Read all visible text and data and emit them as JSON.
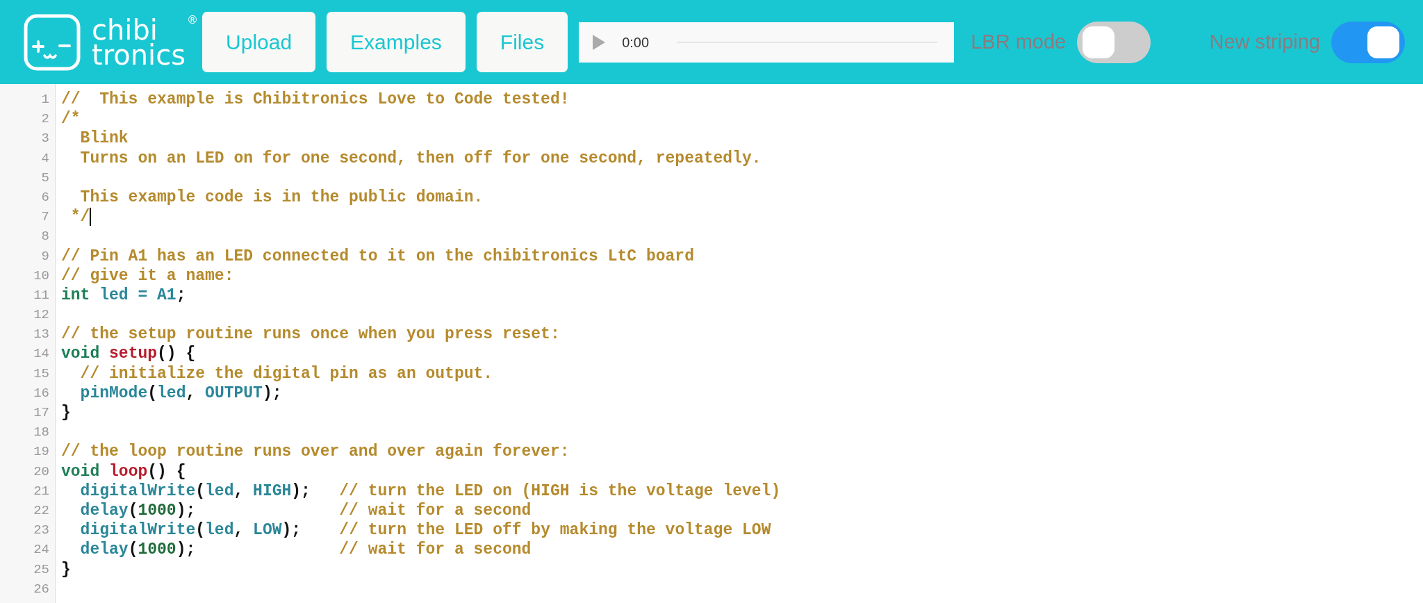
{
  "header": {
    "logo": {
      "line_1": "chibi",
      "line_2": "tronics",
      "mark": "®"
    },
    "buttons": [
      "Upload",
      "Examples",
      "Files"
    ],
    "player": {
      "time": "0:00"
    },
    "toggles": [
      {
        "label": "LBR mode",
        "on": false
      },
      {
        "label": "New striping",
        "on": true
      }
    ]
  },
  "editor": {
    "lines": [
      {
        "number": "1",
        "tokens": [
          {
            "kind": "comment",
            "text": "//  This example is Chibitronics Love to Code tested!"
          }
        ]
      },
      {
        "number": "2",
        "tokens": [
          {
            "kind": "comment",
            "text": "/*"
          }
        ]
      },
      {
        "number": "3",
        "tokens": [
          {
            "kind": "comment",
            "text": "  Blink"
          }
        ]
      },
      {
        "number": "4",
        "tokens": [
          {
            "kind": "comment",
            "text": "  Turns on an LED on for one second, then off for one second, repeatedly."
          }
        ]
      },
      {
        "number": "5"
      },
      {
        "number": "6",
        "tokens": [
          {
            "kind": "comment",
            "text": "  This example code is in the public domain."
          }
        ]
      },
      {
        "number": "7",
        "cursor": true,
        "tokens": [
          {
            "kind": "comment",
            "text": " */"
          }
        ]
      },
      {
        "number": "8"
      },
      {
        "number": "9",
        "tokens": [
          {
            "kind": "comment",
            "text": "// Pin A1 has an LED connected to it on the chibitronics LtC board"
          }
        ]
      },
      {
        "number": "10",
        "tokens": [
          {
            "kind": "comment",
            "text": "// give it a name:"
          }
        ]
      },
      {
        "number": "11",
        "tokens": [
          {
            "kind": "type",
            "text": "int"
          },
          {
            "kind": "name",
            "text": " led = A1"
          },
          {
            "kind": "plain",
            "text": ";"
          }
        ]
      },
      {
        "number": "12"
      },
      {
        "number": "13",
        "tokens": [
          {
            "kind": "comment",
            "text": "// the setup routine runs once when you press reset:"
          }
        ]
      },
      {
        "number": "14",
        "tokens": [
          {
            "kind": "type",
            "text": "void"
          },
          {
            "kind": "function",
            "text": " setup"
          },
          {
            "kind": "plain",
            "text": "() {"
          }
        ]
      },
      {
        "number": "15",
        "tokens": [
          {
            "kind": "comment",
            "text": "  // initialize the digital pin as an output."
          }
        ]
      },
      {
        "number": "16",
        "tokens": [
          {
            "kind": "name",
            "text": "  pinMode"
          },
          {
            "kind": "plain",
            "text": "("
          },
          {
            "kind": "name",
            "text": "led"
          },
          {
            "kind": "plain",
            "text": ", "
          },
          {
            "kind": "name",
            "text": "OUTPUT"
          },
          {
            "kind": "plain",
            "text": ");"
          }
        ]
      },
      {
        "number": "17",
        "tokens": [
          {
            "kind": "plain",
            "text": "}"
          }
        ]
      },
      {
        "number": "18"
      },
      {
        "number": "19",
        "tokens": [
          {
            "kind": "comment",
            "text": "// the loop routine runs over and over again forever:"
          }
        ]
      },
      {
        "number": "20",
        "tokens": [
          {
            "kind": "type",
            "text": "void"
          },
          {
            "kind": "function",
            "text": " loop"
          },
          {
            "kind": "plain",
            "text": "() {"
          }
        ]
      },
      {
        "number": "21",
        "tokens": [
          {
            "kind": "name",
            "text": "  digitalWrite"
          },
          {
            "kind": "plain",
            "text": "("
          },
          {
            "kind": "name",
            "text": "led"
          },
          {
            "kind": "plain",
            "text": ", "
          },
          {
            "kind": "name",
            "text": "HIGH"
          },
          {
            "kind": "plain",
            "text": ");   "
          },
          {
            "kind": "comment",
            "text": "// turn the LED on (HIGH is the voltage level)"
          }
        ]
      },
      {
        "number": "22",
        "tokens": [
          {
            "kind": "name",
            "text": "  delay"
          },
          {
            "kind": "plain",
            "text": "("
          },
          {
            "kind": "number",
            "text": "1000"
          },
          {
            "kind": "plain",
            "text": ");               "
          },
          {
            "kind": "comment",
            "text": "// wait for a second"
          }
        ]
      },
      {
        "number": "23",
        "tokens": [
          {
            "kind": "name",
            "text": "  digitalWrite"
          },
          {
            "kind": "plain",
            "text": "("
          },
          {
            "kind": "name",
            "text": "led"
          },
          {
            "kind": "plain",
            "text": ", "
          },
          {
            "kind": "name",
            "text": "LOW"
          },
          {
            "kind": "plain",
            "text": ");    "
          },
          {
            "kind": "comment",
            "text": "// turn the LED off by making the voltage LOW"
          }
        ]
      },
      {
        "number": "24",
        "tokens": [
          {
            "kind": "name",
            "text": "  delay"
          },
          {
            "kind": "plain",
            "text": "("
          },
          {
            "kind": "number",
            "text": "1000"
          },
          {
            "kind": "plain",
            "text": ");               "
          },
          {
            "kind": "comment",
            "text": "// wait for a second"
          }
        ]
      },
      {
        "number": "25",
        "tokens": [
          {
            "kind": "plain",
            "text": "}"
          }
        ]
      },
      {
        "number": "26"
      }
    ]
  }
}
